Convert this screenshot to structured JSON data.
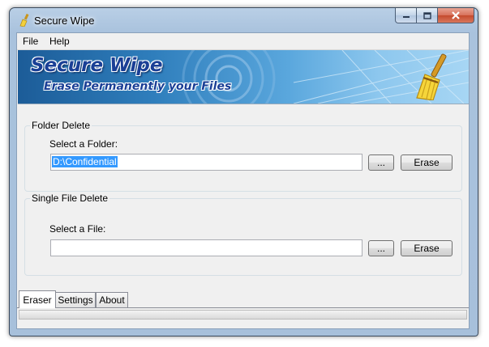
{
  "window": {
    "title": "Secure Wipe"
  },
  "menu": {
    "items": [
      "File",
      "Help"
    ]
  },
  "banner": {
    "title": "Secure Wipe",
    "subtitle": "Erase Permanently your Files"
  },
  "folder_group": {
    "label": "Folder Delete",
    "field_label": "Select a Folder:",
    "value": "D:\\Confidential",
    "browse_label": "...",
    "erase_label": "Erase"
  },
  "file_group": {
    "label": "Single File Delete",
    "field_label": "Select a File:",
    "value": "",
    "browse_label": "...",
    "erase_label": "Erase"
  },
  "tabs": [
    {
      "label": "Eraser",
      "active": true
    },
    {
      "label": "Settings",
      "active": false
    },
    {
      "label": "About",
      "active": false
    }
  ],
  "colors": {
    "selection": "#3399ff",
    "frame": "#a9c2dd",
    "banner_text": "#1a3f96"
  }
}
